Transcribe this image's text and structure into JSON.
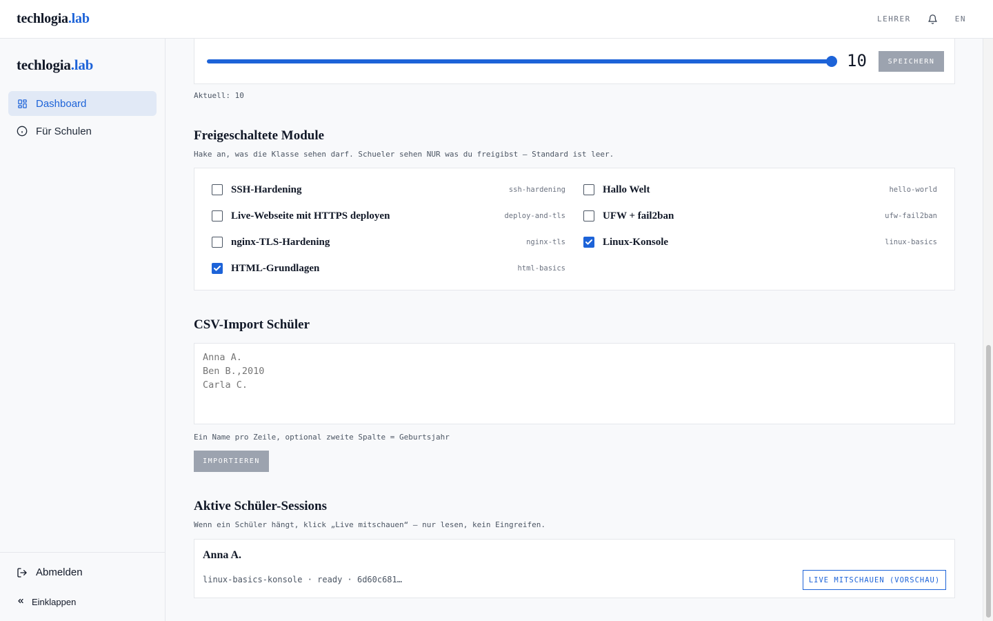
{
  "header": {
    "logo_main": "techlogia",
    "logo_accent": ".lab",
    "role_label": "LEHRER",
    "notifications_icon": "bell-icon",
    "lang_label": "EN"
  },
  "sidebar": {
    "logo_main": "techlogia",
    "logo_accent": ".lab",
    "items": [
      {
        "label": "Dashboard",
        "icon": "dashboard-icon",
        "active": true
      },
      {
        "label": "Für Schulen",
        "icon": "info-icon",
        "active": false
      }
    ],
    "logout_label": "Abmelden",
    "collapse_label": "Einklappen"
  },
  "slider": {
    "value": 10,
    "fill_fraction": 1.0,
    "value_display": "10",
    "save_label": "SPEICHERN",
    "current_text": "Aktuell: 10"
  },
  "modules": {
    "title": "Freigeschaltete Module",
    "hint": "Hake an, was die Klasse sehen darf. Schueler sehen NUR was du freigibst — Standard ist leer.",
    "items": [
      {
        "title": "SSH-Hardening",
        "slug": "ssh-hardening",
        "checked": false
      },
      {
        "title": "Live-Webseite mit HTTPS deployen",
        "slug": "deploy-and-tls",
        "checked": false
      },
      {
        "title": "nginx-TLS-Hardening",
        "slug": "nginx-tls",
        "checked": false
      },
      {
        "title": "HTML-Grundlagen",
        "slug": "html-basics",
        "checked": true
      },
      {
        "title": "Hallo Welt",
        "slug": "hello-world",
        "checked": false
      },
      {
        "title": "UFW + fail2ban",
        "slug": "ufw-fail2ban",
        "checked": false
      },
      {
        "title": "Linux-Konsole",
        "slug": "linux-basics",
        "checked": true
      }
    ]
  },
  "csv": {
    "title": "CSV-Import Schüler",
    "placeholder": "Anna A.\nBen B.,2010\nCarla C.",
    "hint": "Ein Name pro Zeile, optional zweite Spalte = Geburtsjahr",
    "import_label": "IMPORTIEREN"
  },
  "sessions": {
    "title": "Aktive Schüler-Sessions",
    "hint": "Wenn ein Schüler hängt, klick „Live mitschauen“ — nur lesen, kein Eingreifen.",
    "items": [
      {
        "name": "Anna A.",
        "meta": "linux-basics-konsole · ready · 6d60c681…",
        "action_label": "LIVE MITSCHAUEN (VORSCHAU)"
      }
    ]
  },
  "colors": {
    "accent": "#1d63d8",
    "disabled_button": "#9ca3af",
    "active_nav_bg": "#e1e9f6"
  }
}
